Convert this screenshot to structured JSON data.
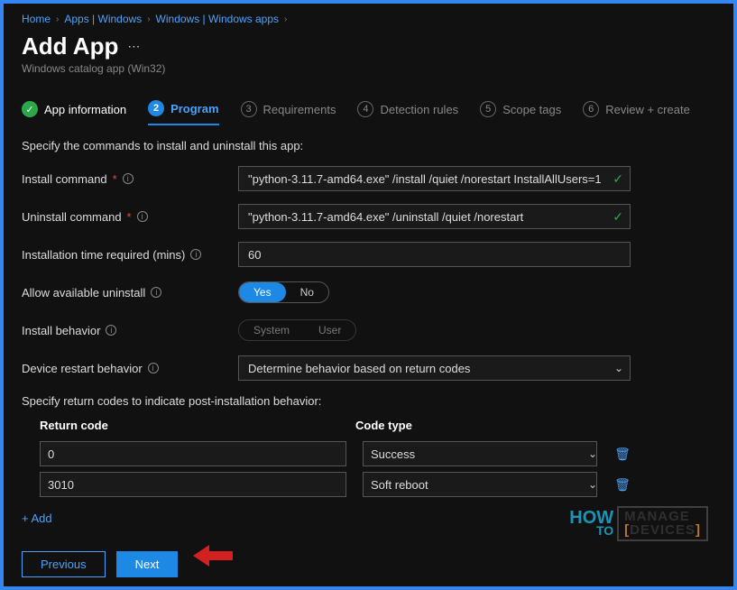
{
  "breadcrumb": [
    "Home",
    "Apps | Windows",
    "Windows | Windows apps"
  ],
  "page_title": "Add App",
  "subtitle": "Windows catalog app (Win32)",
  "steps": [
    {
      "num": "✓",
      "label": "App information",
      "state": "completed"
    },
    {
      "num": "2",
      "label": "Program",
      "state": "active"
    },
    {
      "num": "3",
      "label": "Requirements",
      "state": ""
    },
    {
      "num": "4",
      "label": "Detection rules",
      "state": ""
    },
    {
      "num": "5",
      "label": "Scope tags",
      "state": ""
    },
    {
      "num": "6",
      "label": "Review + create",
      "state": ""
    }
  ],
  "section_intro": "Specify the commands to install and uninstall this app:",
  "fields": {
    "install_cmd": {
      "label": "Install command",
      "required": true,
      "value": "\"python-3.11.7-amd64.exe\" /install /quiet /norestart InstallAllUsers=1"
    },
    "uninstall_cmd": {
      "label": "Uninstall command",
      "required": true,
      "value": "\"python-3.11.7-amd64.exe\" /uninstall /quiet /norestart"
    },
    "install_time": {
      "label": "Installation time required (mins)",
      "value": "60"
    },
    "allow_uninstall": {
      "label": "Allow available uninstall",
      "options": [
        "Yes",
        "No"
      ],
      "selected": "Yes"
    },
    "install_behavior": {
      "label": "Install behavior",
      "options": [
        "System",
        "User"
      ],
      "selected": "System",
      "disabled": true
    },
    "restart_behavior": {
      "label": "Device restart behavior",
      "value": "Determine behavior based on return codes"
    }
  },
  "return_codes": {
    "intro": "Specify return codes to indicate post-installation behavior:",
    "headers": {
      "code": "Return code",
      "type": "Code type"
    },
    "rows": [
      {
        "code": "0",
        "type": "Success"
      },
      {
        "code": "3010",
        "type": "Soft reboot"
      }
    ],
    "add_label": "+ Add"
  },
  "buttons": {
    "previous": "Previous",
    "next": "Next"
  },
  "watermark": {
    "how": "HOW",
    "to": "TO",
    "l1": "MANAGE",
    "l2": "DEVICES"
  }
}
